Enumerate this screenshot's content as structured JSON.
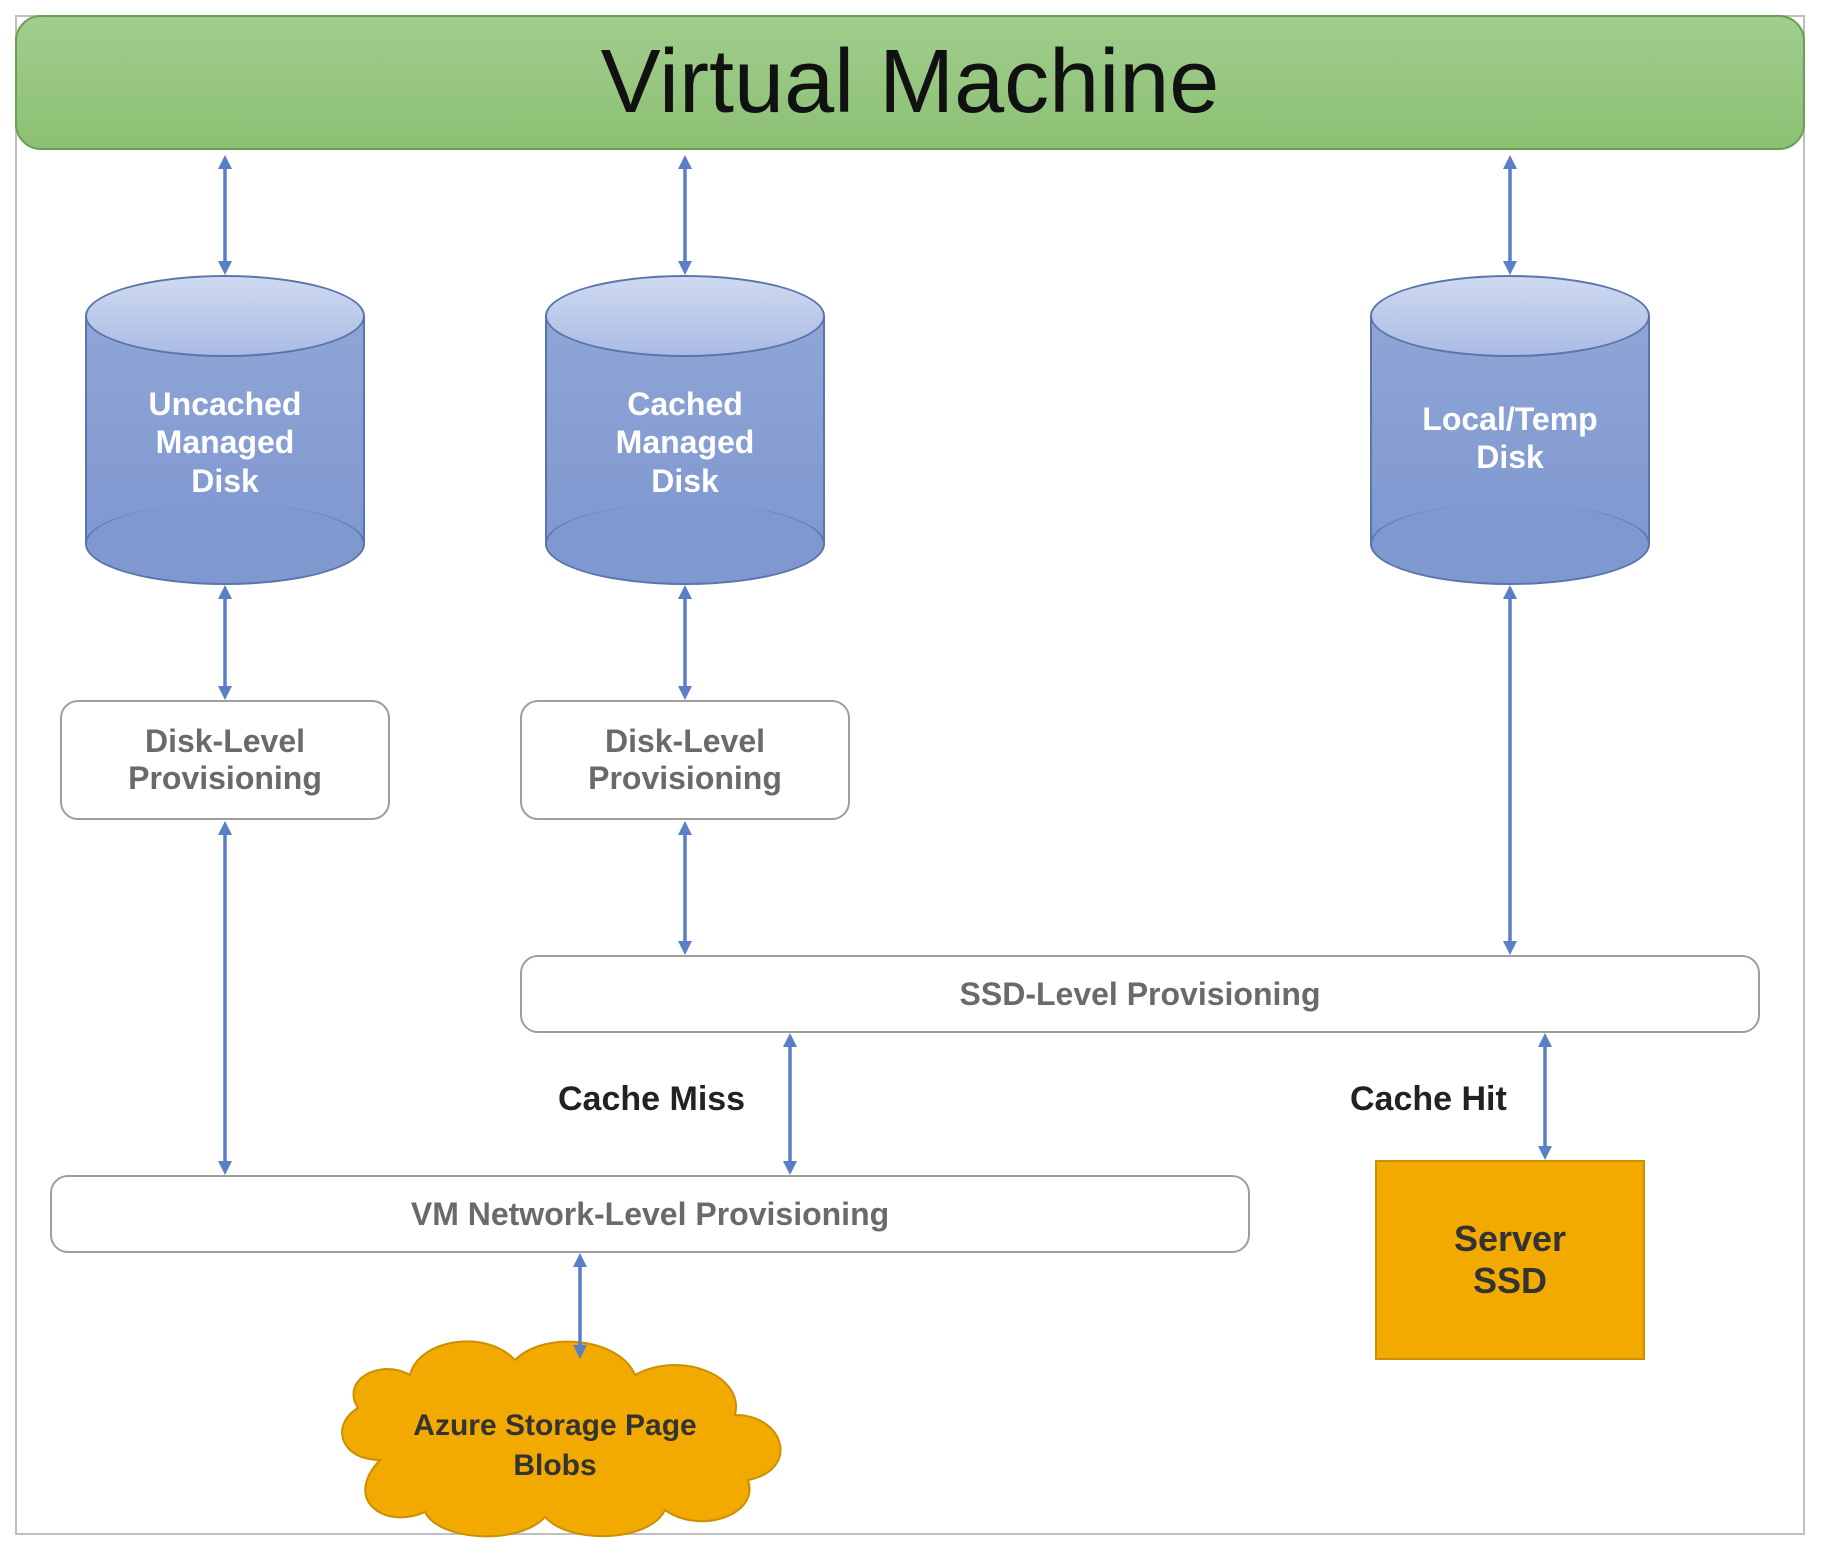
{
  "title": "Virtual Machine",
  "disks": {
    "uncached": "Uncached\nManaged\nDisk",
    "cached": "Cached\nManaged\nDisk",
    "local": "Local/Temp\nDisk"
  },
  "boxes": {
    "disk_prov_1": "Disk-Level\nProvisioning",
    "disk_prov_2": "Disk-Level\nProvisioning",
    "ssd_prov": "SSD-Level Provisioning",
    "vm_net_prov": "VM Network-Level Provisioning"
  },
  "labels": {
    "cache_miss": "Cache Miss",
    "cache_hit": "Cache Hit"
  },
  "cloud": "Azure Storage Page\nBlobs",
  "server_ssd": "Server\nSSD",
  "colors": {
    "vm_bar": "#8cc073",
    "cylinder": "#7f98d0",
    "arrow": "#5b7fc7",
    "orange": "#f2a900",
    "box_border": "#9e9e9e",
    "text_grey": "#6a6a6a"
  }
}
